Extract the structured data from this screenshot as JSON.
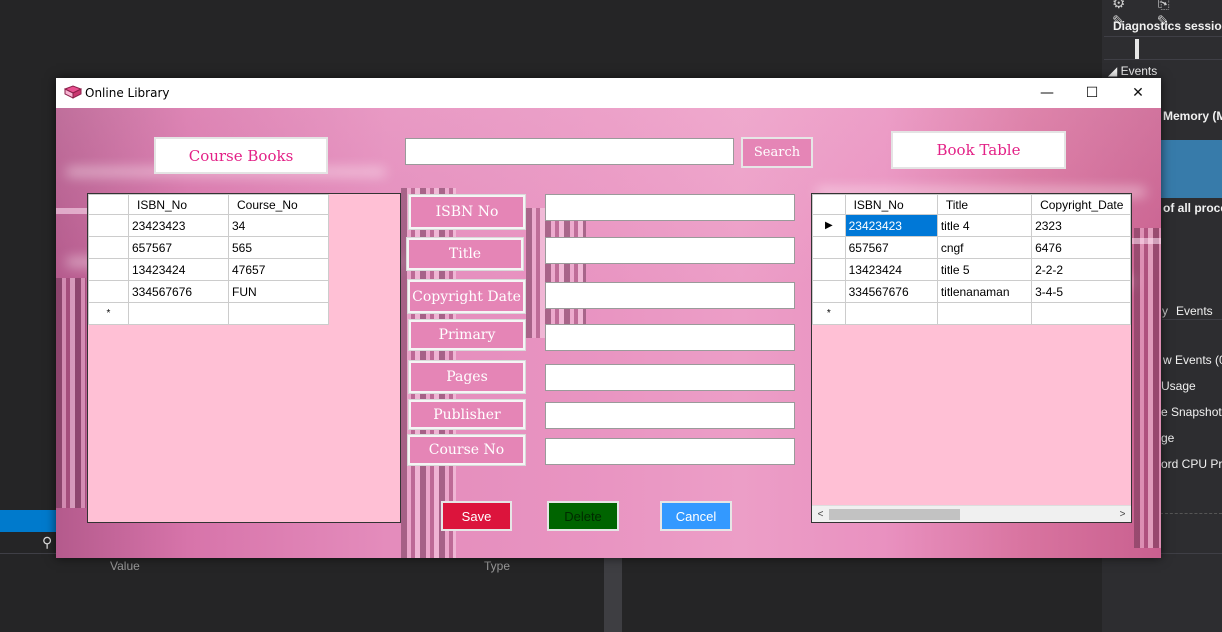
{
  "ide": {
    "diagnostics_title": "Diagnostics session:",
    "events_header": "◢ Events",
    "memory_label": "Memory (M",
    "of_all_processes": "of all proce",
    "tab_partial": "y",
    "tab_events": "Events",
    "list_items": [
      "w Events (0",
      "Usage",
      "e Snapshot",
      "ge",
      "ord CPU Pro"
    ],
    "col_value": "Value",
    "col_type": "Type",
    "toolbar_icons": "⚙ ⎘ ✎ ✎"
  },
  "window": {
    "title": "Online Library",
    "minimize": "—",
    "maximize": "☐",
    "close": "✕"
  },
  "form": {
    "course_books_label": "Course Books",
    "book_table_label": "Book Table",
    "search_value": "",
    "search_button": "Search",
    "fields": [
      {
        "label": "ISBN No",
        "value": ""
      },
      {
        "label": "Title",
        "value": ""
      },
      {
        "label": "Copyright Date",
        "value": ""
      },
      {
        "label": "Primary",
        "value": ""
      },
      {
        "label": "Pages",
        "value": ""
      },
      {
        "label": "Publisher",
        "value": ""
      },
      {
        "label": "Course No",
        "value": ""
      }
    ],
    "save_button": "Save",
    "delete_button": "Delete",
    "cancel_button": "Cancel"
  },
  "course_grid": {
    "columns": [
      "ISBN_No",
      "Course_No"
    ],
    "rows": [
      [
        "23423423",
        "34"
      ],
      [
        "657567",
        "565"
      ],
      [
        "13423424",
        "47657"
      ],
      [
        "334567676",
        "FUN"
      ]
    ],
    "new_row_marker": "*"
  },
  "book_grid": {
    "columns": [
      "ISBN_No",
      "Title",
      "Copyright_Date"
    ],
    "rows": [
      [
        "23423423",
        "title 4",
        "2323"
      ],
      [
        "657567",
        "cngf",
        "6476"
      ],
      [
        "13423424",
        "title 5",
        "2-2-2"
      ],
      [
        "334567676",
        "titlenanaman",
        "3-4-5"
      ]
    ],
    "current_row_marker": "▶",
    "new_row_marker": "*",
    "scroll_left": "<",
    "scroll_right": ">"
  },
  "colors": {
    "pink_label": "#e585b6",
    "grid_background": "#ffc0d5",
    "save": "#dc143c",
    "delete": "#006400",
    "cancel": "#3399ff",
    "selected_cell": "#0078d7"
  }
}
